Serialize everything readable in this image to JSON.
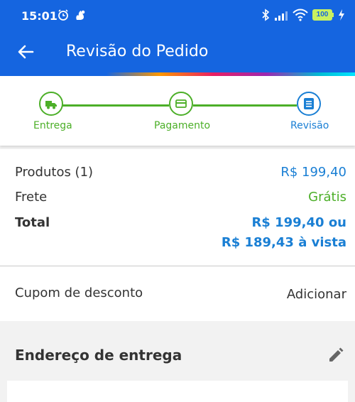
{
  "status_bar": {
    "time": "15:01",
    "battery": "100",
    "icons": [
      "alarm-icon",
      "app-notification-icon",
      "bluetooth-icon",
      "signal-icon",
      "wifi-icon",
      "battery-icon",
      "charging-icon"
    ]
  },
  "app_bar": {
    "title": "Revisão do Pedido",
    "back_icon": "arrow-back-icon"
  },
  "stepper": {
    "steps": [
      {
        "label": "Entrega",
        "icon": "truck-icon",
        "state": "done"
      },
      {
        "label": "Pagamento",
        "icon": "credit-card-icon",
        "state": "done"
      },
      {
        "label": "Revisão",
        "icon": "list-icon",
        "state": "current"
      }
    ]
  },
  "summary": {
    "products_label": "Produtos (1)",
    "products_value": "R$ 199,40",
    "shipping_label": "Frete",
    "shipping_value": "Grátis",
    "total_label": "Total",
    "total_value_line1": "R$ 199,40 ou",
    "total_value_line2": "R$ 189,43 à vista"
  },
  "coupon": {
    "label": "Cupom de desconto",
    "action": "Adicionar"
  },
  "address": {
    "title": "Endereço de entrega",
    "edit_icon": "pencil-icon"
  },
  "colors": {
    "primary": "#1565e0",
    "success": "#4caf28",
    "price_blue": "#1a7fd4"
  }
}
